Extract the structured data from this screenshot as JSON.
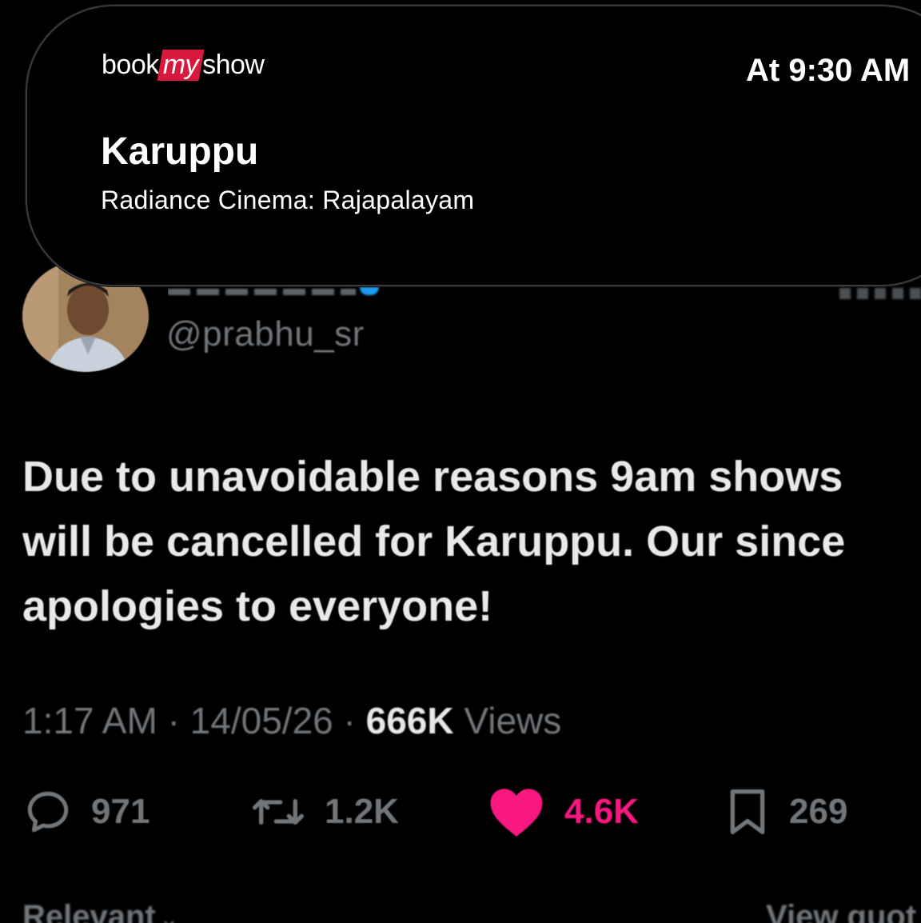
{
  "tweet": {
    "handle": "@prabhu_sr",
    "text_lines": [
      "Due to unavoidable reasons 9am shows",
      "will be cancelled for Karuppu. Our since",
      "apologies to everyone!"
    ],
    "time": "1:17 AM",
    "date": "14/05/26",
    "views_count": "666K",
    "views_label": "Views",
    "stats": {
      "replies": "971",
      "reposts": "1.2K",
      "likes": "4.6K",
      "bookmarks": "269"
    },
    "like_color": "#f91880",
    "verified_color": "#1d9bf0"
  },
  "replies_bar": {
    "sort_label": "Relevant",
    "view_quotes": "View quot"
  },
  "notification": {
    "brand": {
      "pre": "book",
      "highlight": "my",
      "post": "show",
      "color": "#d8183d"
    },
    "time": "At 9:30 AM",
    "title": "Karuppu",
    "subtitle": "Radiance Cinema: Rajapalayam"
  },
  "icons": [
    "reply-icon",
    "repost-icon",
    "like-icon",
    "bookmark-icon",
    "chevron-down-icon",
    "verified-badge-icon"
  ]
}
